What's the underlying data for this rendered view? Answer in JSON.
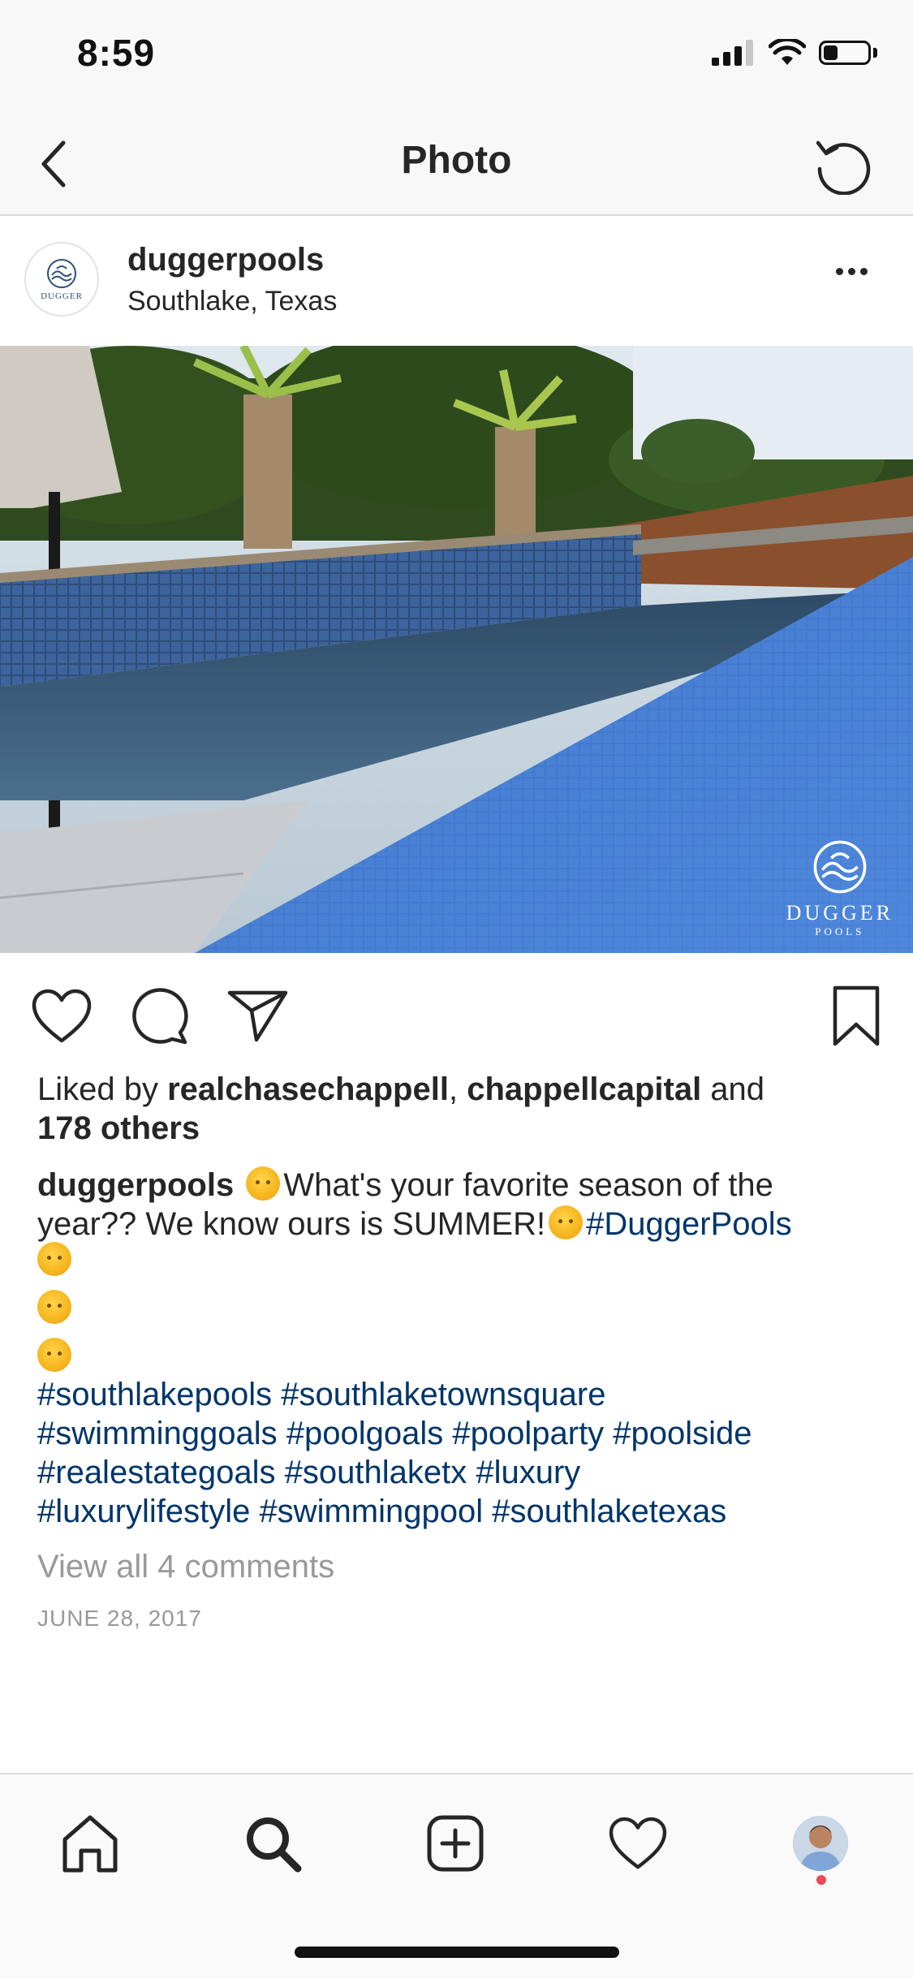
{
  "status": {
    "time": "8:59",
    "battery_level": 0.3
  },
  "nav": {
    "title": "Photo"
  },
  "post": {
    "username": "duggerpools",
    "location": "Southlake, Texas",
    "avatar_logo_text": "DUGGER",
    "watermark_text": "DUGGER",
    "watermark_sub": "POOLS",
    "liked_by_prefix": "Liked by ",
    "liked_user_1": "realchasechappell",
    "liked_sep": ", ",
    "liked_user_2": "chappellcapital",
    "liked_and": " and",
    "liked_others": "178 others",
    "caption_user": "duggerpools",
    "caption_text_1": "What's your favorite season of the year?? We know ours is SUMMER!",
    "caption_tag_main": "#DuggerPools",
    "hashtag_lines": [
      "#southlakepools #southlaketownsquare",
      "#swimminggoals #poolgoals #poolparty #poolside",
      "#realestategoals #southlaketx #luxury",
      "#luxurylifestyle #swimmingpool #southlaketexas"
    ],
    "view_comments": "View all 4 comments",
    "date": "JUNE 28, 2017"
  },
  "icons": {
    "back": "chevron-left-icon",
    "refresh": "refresh-icon",
    "more": "more-icon",
    "like": "heart-icon",
    "comment": "comment-icon",
    "share": "send-icon",
    "save": "bookmark-icon",
    "tab_home": "home-icon",
    "tab_search": "search-icon",
    "tab_add": "add-icon",
    "tab_activity": "heart-icon",
    "tab_profile": "avatar"
  },
  "colors": {
    "link": "#003569",
    "muted": "#999999",
    "notification": "#ed4956"
  }
}
